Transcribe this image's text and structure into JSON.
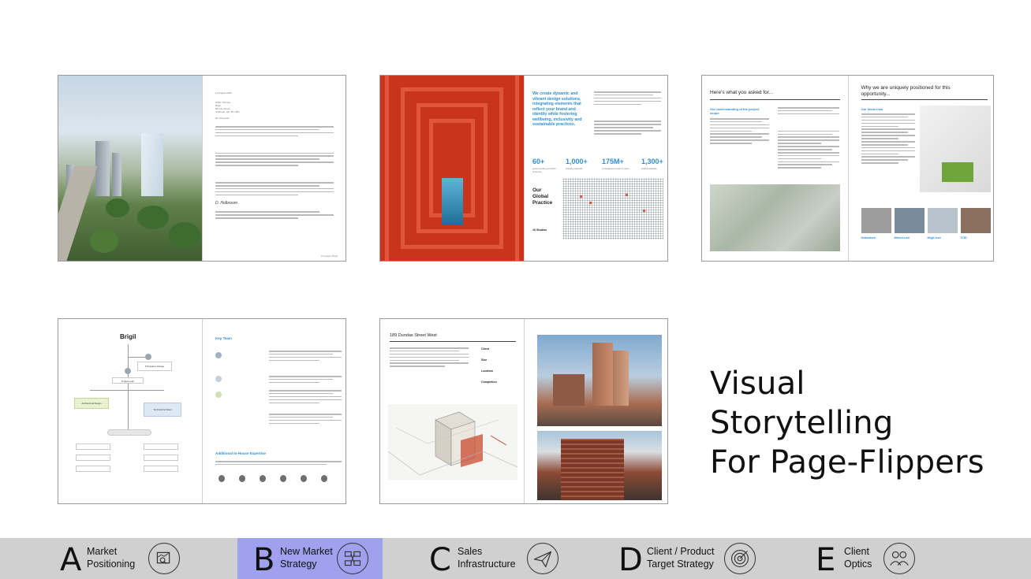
{
  "headline": {
    "line1": "Visual Storytelling",
    "line2": "For Page-Flippers"
  },
  "spreads": [
    {
      "id": "letter",
      "right_lines": [
        "12 August 2021",
        "Philip Thomas",
        "Brigil",
        "98 Lois Street",
        "Gatineau, QC J8Y 3R7",
        "Re: Proposal"
      ],
      "signature": "D. Holbroom",
      "footer": "Proposal | Brigil"
    },
    {
      "id": "global-practice",
      "tagline": "We create dynamic and vibrant design solutions, integrating elements that reflect your brand and identity while fostering wellbeing, inclusivity and sustainable practices.",
      "stats": [
        {
          "value": "60+",
          "label": "years working in North America"
        },
        {
          "value": "1,000+",
          "label": "industry awards"
        },
        {
          "value": "175M+",
          "label": "sf designed in last 5 years"
        },
        {
          "value": "1,300+",
          "label": "staff worldwide"
        }
      ],
      "practice_title": [
        "Our",
        "Global",
        "Practice"
      ],
      "studios": "16 Studios"
    },
    {
      "id": "approach",
      "left_heading": "Here's what you asked for...",
      "left_sub": "Our understanding of the project scope",
      "right_heading": "Why we are uniquely positioned for this opportunity...",
      "right_sub": "Our know-how",
      "pillars": [
        "Urbanism",
        "Mixed-use",
        "High-rise",
        "TOD"
      ]
    },
    {
      "id": "team",
      "org_title": "Brigil",
      "roles": [
        "Principal-in-Charge",
        "Project Lead",
        "Architectural Design",
        "Technical Architect"
      ],
      "right_heading": "Key Team",
      "expertise_heading": "Additional In-House Expertise"
    },
    {
      "id": "project",
      "title": "189 Dundas Street West",
      "fields": [
        "Client",
        "Size",
        "Location",
        "Completion"
      ]
    }
  ],
  "nav": [
    {
      "letter": "A",
      "label_line1": "Market",
      "label_line2": "Positioning",
      "icon": "chart-magnifier-icon",
      "active": false
    },
    {
      "letter": "B",
      "label_line1": "New Market",
      "label_line2": "Strategy",
      "icon": "strategy-flow-icon",
      "active": true
    },
    {
      "letter": "C",
      "label_line1": "Sales",
      "label_line2": "Infrastructure",
      "icon": "paper-plane-icon",
      "active": false
    },
    {
      "letter": "D",
      "label_line1": "Client / Product",
      "label_line2": "Target Strategy",
      "icon": "target-icon",
      "active": false
    },
    {
      "letter": "E",
      "label_line1": "Client",
      "label_line2": "Optics",
      "icon": "people-icon",
      "active": false
    }
  ],
  "colors": {
    "nav_bg": "#d0d0d0",
    "nav_active": "#9fa0ee",
    "accent_blue": "#2e8fd6",
    "corridor_red": "#c8341c"
  }
}
